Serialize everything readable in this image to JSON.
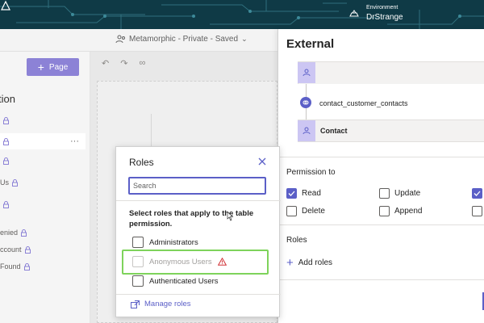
{
  "topbar": {
    "environment_label": "Environment",
    "environment_name": "DrStrange"
  },
  "toolbar": {
    "site_title": "Metamorphic - Private - Saved"
  },
  "left_panel": {
    "add_page_label": "Page",
    "heading": "tion",
    "items": [
      {
        "label": ""
      },
      {
        "label": ""
      },
      {
        "label": ""
      },
      {
        "label": "Us"
      },
      {
        "label": ""
      },
      {
        "label": "enied"
      },
      {
        "label": "ccount"
      },
      {
        "label": "Found"
      }
    ]
  },
  "right_panel": {
    "title": "External",
    "relationship_link": "contact_customer_contacts",
    "contact_table": "Contact",
    "permission_heading": "Permission to",
    "permissions": [
      {
        "label": "Read",
        "checked": true
      },
      {
        "label": "Update",
        "checked": false
      },
      {
        "label": "",
        "checked": true
      },
      {
        "label": "Delete",
        "checked": false
      },
      {
        "label": "Append",
        "checked": false
      },
      {
        "label": "",
        "checked": false
      }
    ],
    "roles_heading": "Roles",
    "add_roles_label": "Add roles"
  },
  "roles_popup": {
    "title": "Roles",
    "search_placeholder": "Search",
    "instruction": "Select roles that apply to the table permission.",
    "roles": [
      {
        "label": "Administrators",
        "checked": false,
        "disabled": false
      },
      {
        "label": "Anonymous Users",
        "checked": false,
        "disabled": true,
        "warning": true
      },
      {
        "label": "Authenticated Users",
        "checked": false,
        "disabled": false
      }
    ],
    "manage_roles_label": "Manage roles"
  },
  "colors": {
    "accent": "#5b5fc7",
    "banner": "#0f3a46",
    "highlight": "#7ed35b",
    "warning": "#d13438"
  }
}
